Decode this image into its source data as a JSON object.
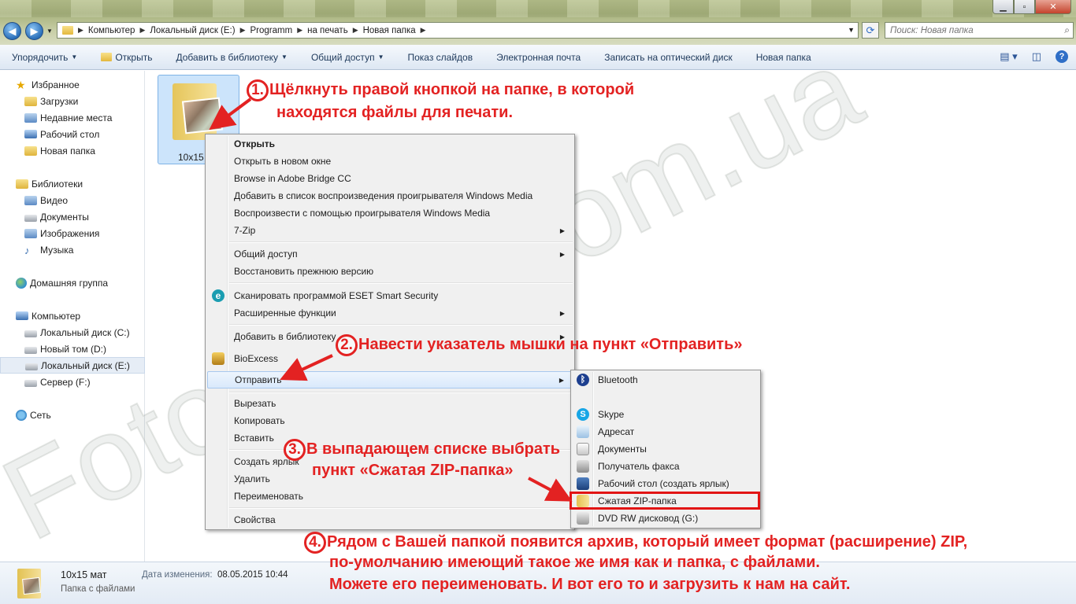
{
  "window": {
    "address": [
      "Компьютер",
      "Локальный диск (E:)",
      "Programm",
      "на печать",
      "Новая папка"
    ],
    "search_placeholder": "Поиск: Новая папка",
    "minimize_glyph": "▁",
    "maximize_glyph": "▫",
    "close_glyph": "✕"
  },
  "toolbar": {
    "organize": "Упорядочить",
    "open": "Открыть",
    "add_library": "Добавить в библиотеку",
    "share": "Общий доступ",
    "slideshow": "Показ слайдов",
    "email": "Электронная почта",
    "burn": "Записать на оптический диск",
    "new_folder": "Новая папка"
  },
  "sidebar": {
    "favorites": "Избранное",
    "fav_items": [
      "Загрузки",
      "Недавние места",
      "Рабочий стол",
      "Новая папка"
    ],
    "libraries": "Библиотеки",
    "lib_items": [
      "Видео",
      "Документы",
      "Изображения",
      "Музыка"
    ],
    "homegroup": "Домашняя группа",
    "computer": "Компьютер",
    "drives": [
      "Локальный диск (C:)",
      "Новый том (D:)",
      "Локальный диск (E:)",
      "Сервер (F:)"
    ],
    "network": "Сеть"
  },
  "content": {
    "folder_label": "10x15 ("
  },
  "context_menu": {
    "items": [
      "Открыть",
      "Открыть в новом окне",
      "Browse in Adobe Bridge CC",
      "Добавить в список воспроизведения проигрывателя Windows Media",
      "Воспроизвести с помощью проигрывателя Windows Media",
      "7-Zip",
      "Общий доступ",
      "Восстановить прежнюю версию",
      "Сканировать программой ESET Smart Security",
      "Расширенные функции",
      "Добавить в библиотеку",
      "BioExcess",
      "Отправить",
      "Вырезать",
      "Копировать",
      "Вставить",
      "Создать ярлык",
      "Удалить",
      "Переименовать",
      "Свойства"
    ]
  },
  "sendto_menu": {
    "items": [
      "Bluetooth",
      "Skype",
      "Адресат",
      "Документы",
      "Получатель факса",
      "Рабочий стол (создать ярлык)",
      "Сжатая ZIP-папка",
      "DVD RW дисковод (G:)"
    ]
  },
  "status": {
    "name": "10x15 мат",
    "type": "Папка с файлами",
    "date_label": "Дата изменения:",
    "date_value": "08.05.2015 10:44"
  },
  "annotations": {
    "n1": "1.",
    "a1_line1": "Щёлкнуть правой кнопкой  на папке, в которой",
    "a1_line2": "находятся файлы для печати.",
    "n2": "2.",
    "a2": "Навести указатель мышки на пункт «Отправить»",
    "n3": "3.",
    "a3_line1": "В выпадающем списке выбрать",
    "a3_line2": "пункт «Сжатая ZIP-папка»",
    "n4": "4.",
    "a4_line1": "Рядом с Вашей папкой появится архив, который имеет формат (расширение) ZIP,",
    "a4_line2": "по-умолчанию имеющий такое же имя как и папка, с файлами.",
    "a4_line3": "Можете его переименовать. И вот его то и загрузить к нам на сайт."
  },
  "watermark": "Foto-Print.com.ua",
  "colors": {
    "annotation": "#e32222",
    "highlight_box": "#e21414"
  }
}
